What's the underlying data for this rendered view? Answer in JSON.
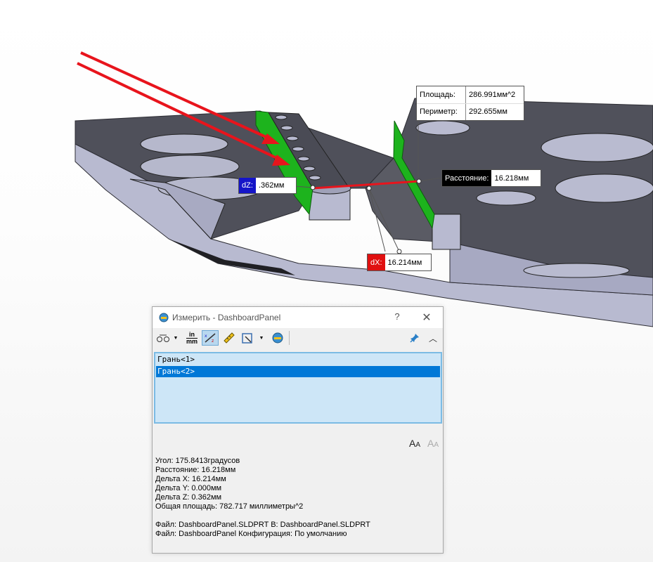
{
  "callouts": {
    "area_label": "Площадь:",
    "area_value": "286.991мм^2",
    "perimeter_label": "Периметр:",
    "perimeter_value": "292.655мм",
    "distance_label": "Расстояние:",
    "distance_value": "16.218мм",
    "dz_label": "dZ:",
    "dz_value": ".362мм",
    "dx_label": "dX:",
    "dx_value": "16.214мм"
  },
  "dialog": {
    "title": "Измерить - DashboardPanel",
    "help": "?",
    "close": "✕",
    "toolbar": {
      "units_top": "in",
      "units_bottom": "mm"
    },
    "selections": [
      "Грань<1>",
      "Грань<2>"
    ],
    "selected_index": 1,
    "results": [
      "Угол: 175.8413градусов",
      "Расстояние: 16.218мм",
      "Дельта X: 16.214мм",
      "Дельта Y: 0.000мм",
      "Дельта Z: 0.362мм",
      "Общая площадь: 782.717 миллиметры^2"
    ],
    "files": [
      "Файл: DashboardPanel.SLDPRT В: DashboardPanel.SLDPRT",
      "Файл: DashboardPanel Конфигурация: По умолчанию"
    ]
  },
  "colors": {
    "part_top": "#4d4e57",
    "part_side": "#b7b9cf",
    "face_highlight": "#1db31d",
    "arrow": "#e8141c",
    "dz_badge": "#1515c8",
    "dx_badge": "#e01010",
    "selection_bg": "#0078d7"
  }
}
